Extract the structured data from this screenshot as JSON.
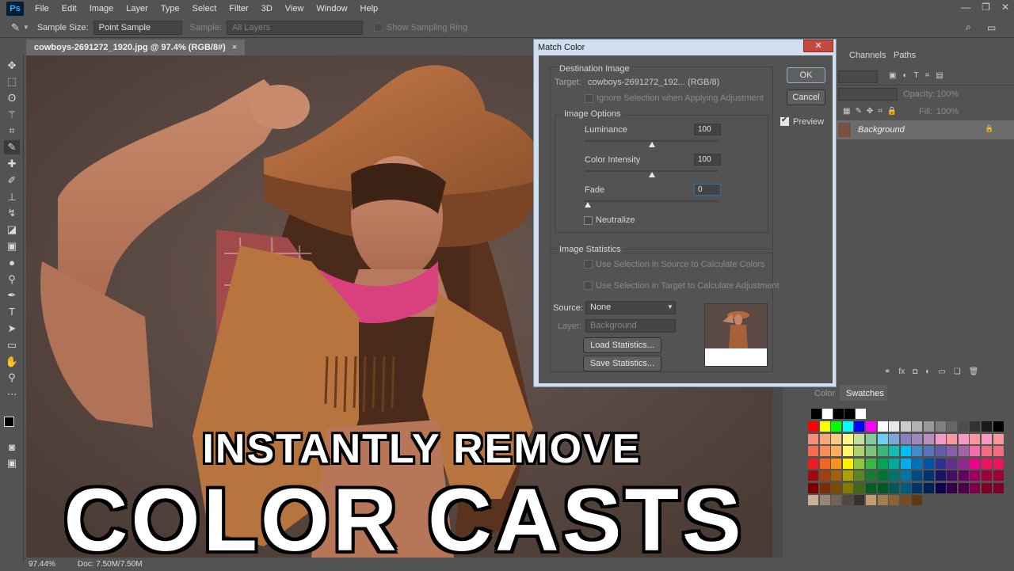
{
  "app": {
    "logo": "Ps"
  },
  "menu": [
    "File",
    "Edit",
    "Image",
    "Layer",
    "Type",
    "Select",
    "Filter",
    "3D",
    "View",
    "Window",
    "Help"
  ],
  "window_controls": {
    "minimize": "—",
    "restore": "❐",
    "close": "✕"
  },
  "options_bar": {
    "sample_size_label": "Sample Size:",
    "sample_size_value": "Point Sample",
    "sample_label": "Sample:",
    "sample_value": "All Layers",
    "show_ring_label": "Show Sampling Ring"
  },
  "document": {
    "tab_title": "cowboys-2691272_1920.jpg @ 97.4% (RGB/8#)",
    "tab_close": "×",
    "zoom": "97.44%",
    "doc_size": "Doc: 7.50M/7.50M"
  },
  "overlay": {
    "line1": "INSTANTLY REMOVE",
    "line2": "COLOR CASTS"
  },
  "dialog": {
    "title": "Match Color",
    "close": "✕",
    "destination": {
      "heading": "Destination Image",
      "target_label": "Target:",
      "target_value": "cowboys-2691272_192... (RGB/8)",
      "ignore_selection": "Ignore Selection when Applying Adjustment"
    },
    "image_options": {
      "heading": "Image Options",
      "luminance_label": "Luminance",
      "luminance_value": "100",
      "color_intensity_label": "Color Intensity",
      "color_intensity_value": "100",
      "fade_label": "Fade",
      "fade_value": "0",
      "neutralize_label": "Neutralize"
    },
    "image_statistics": {
      "heading": "Image Statistics",
      "use_source": "Use Selection in Source to Calculate Colors",
      "use_target": "Use Selection in Target to Calculate Adjustment",
      "source_label": "Source:",
      "source_value": "None",
      "layer_label": "Layer:",
      "layer_value": "Background",
      "load_button": "Load Statistics...",
      "save_button": "Save Statistics..."
    },
    "ok_button": "OK",
    "cancel_button": "Cancel",
    "preview_label": "Preview",
    "preview_checked": "✔"
  },
  "layers_panel": {
    "tab_channels": "Channels",
    "tab_paths": "Paths",
    "opacity_label": "Opacity:",
    "opacity_value": "100%",
    "fill_label": "Fill:",
    "fill_value": "100%",
    "layer_name": "Background",
    "lock_icon": "🔒",
    "footer_icons": [
      "⚭",
      "fx",
      "◘",
      "◐",
      "▭",
      "❏",
      "🗑"
    ]
  },
  "swatches_panel": {
    "tab_color": "Color",
    "tab_swatches": "Swatches"
  }
}
